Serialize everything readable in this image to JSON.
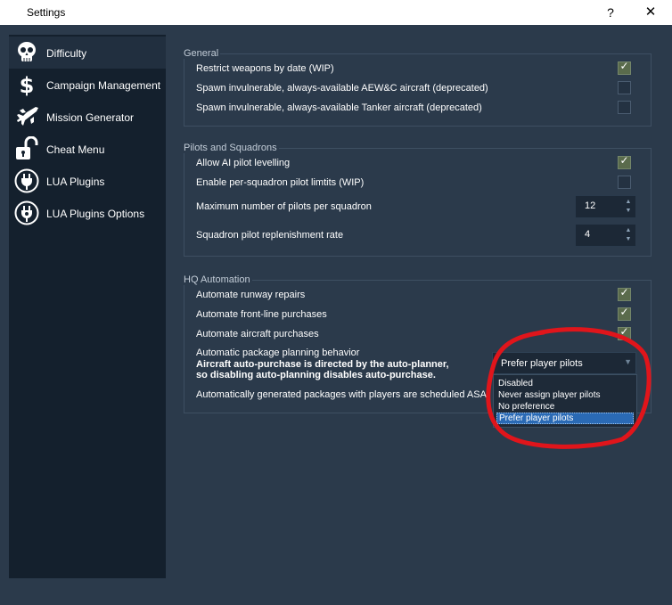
{
  "window": {
    "title": "Settings",
    "help_label": "?",
    "close_label": "✕"
  },
  "sidebar": {
    "items": [
      {
        "label": "Difficulty",
        "icon": "skull-icon",
        "active": true
      },
      {
        "label": "Campaign Management",
        "icon": "dollar-icon"
      },
      {
        "label": "Mission Generator",
        "icon": "jet-icon"
      },
      {
        "label": "Cheat Menu",
        "icon": "unlock-icon"
      },
      {
        "label": "LUA Plugins",
        "icon": "plug-icon"
      },
      {
        "label": "LUA Plugins Options",
        "icon": "plug-gear-icon"
      }
    ]
  },
  "general": {
    "title": "General",
    "rows": [
      {
        "label": "Restrict weapons by date (WIP)",
        "checked": true
      },
      {
        "label": "Spawn invulnerable, always-available AEW&C aircraft (deprecated)",
        "checked": false
      },
      {
        "label": "Spawn invulnerable, always-available Tanker aircraft (deprecated)",
        "checked": false
      }
    ]
  },
  "pilots": {
    "title": "Pilots and Squadrons",
    "rows": [
      {
        "label": "Allow AI pilot levelling",
        "checked": true
      },
      {
        "label": "Enable per-squadron pilot limtits (WIP)",
        "checked": false
      }
    ],
    "max_pilots_label": "Maximum number of pilots per squadron",
    "max_pilots_value": "12",
    "replenish_label": "Squadron pilot replenishment rate",
    "replenish_value": "4"
  },
  "hq": {
    "title": "HQ Automation",
    "rows": [
      {
        "label": "Automate runway repairs",
        "checked": true
      },
      {
        "label": "Automate front-line purchases",
        "checked": true
      },
      {
        "label": "Automate aircraft purchases",
        "checked": true
      }
    ],
    "planning_label": "Automatic package planning behavior",
    "planning_note_line1": "Aircraft auto-purchase is directed by the auto-planner,",
    "planning_note_line2": "so disabling auto-planning disables auto-purchase.",
    "scheduled_label": "Automatically generated packages with players are scheduled ASAP",
    "planning_value": "Prefer player pilots",
    "planning_options": [
      "Disabled",
      "Never assign player pilots",
      "No preference",
      "Prefer player pilots"
    ],
    "planning_selected_index": 3
  },
  "colors": {
    "background": "#2b3a4b",
    "sidebar": "#14202d",
    "selection": "#2a6ab5",
    "annotation": "#e0151b"
  }
}
